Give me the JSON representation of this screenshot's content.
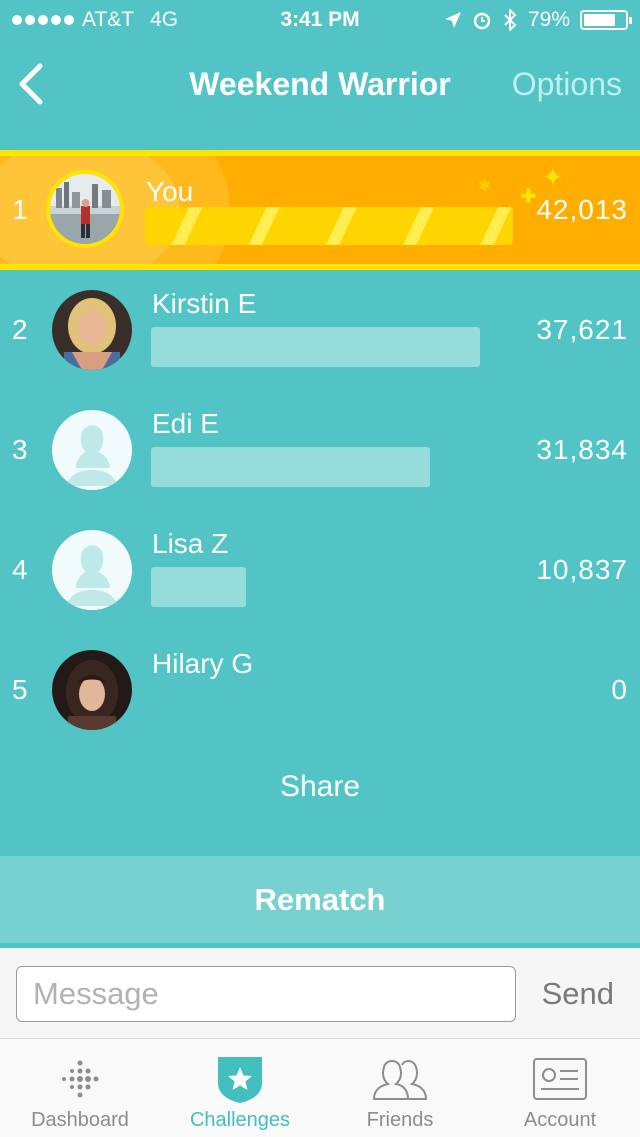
{
  "status_bar": {
    "carrier": "AT&T",
    "network": "4G",
    "time": "3:41 PM",
    "battery": "79%"
  },
  "nav": {
    "title": "Weekend Warrior",
    "options_label": "Options"
  },
  "leaderboard": [
    {
      "rank": "1",
      "name": "You",
      "steps": "42,013",
      "progress": 1.0
    },
    {
      "rank": "2",
      "name": "Kirstin E",
      "steps": "37,621",
      "progress": 0.895
    },
    {
      "rank": "3",
      "name": "Edi E",
      "steps": "31,834",
      "progress": 0.758
    },
    {
      "rank": "4",
      "name": "Lisa Z",
      "steps": "10,837",
      "progress": 0.258
    },
    {
      "rank": "5",
      "name": "Hilary G",
      "steps": "0",
      "progress": 0
    }
  ],
  "actions": {
    "share_label": "Share",
    "rematch_label": "Rematch"
  },
  "composer": {
    "placeholder": "Message",
    "value": "",
    "send_label": "Send"
  },
  "tabs": [
    {
      "label": "Dashboard",
      "icon": "dashboard-dots-icon",
      "active": false
    },
    {
      "label": "Challenges",
      "icon": "challenges-star-icon",
      "active": true
    },
    {
      "label": "Friends",
      "icon": "friends-icon",
      "active": false
    },
    {
      "label": "Account",
      "icon": "account-card-icon",
      "active": false
    }
  ],
  "colors": {
    "teal": "#52c4c5",
    "gold": "#ffad00",
    "highlight": "#ffe400",
    "bar": "#96dcdb"
  }
}
